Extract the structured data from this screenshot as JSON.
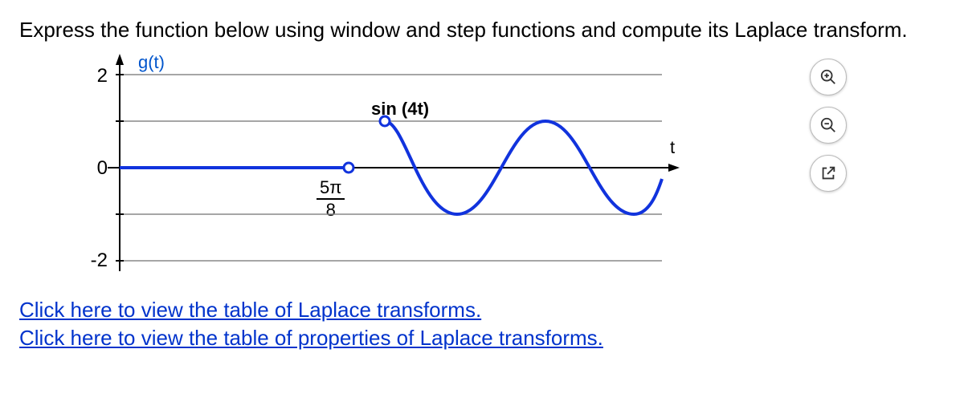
{
  "question": "Express the function below using window and step functions and compute its Laplace transform.",
  "graph": {
    "y_axis_label_function": "g(t)",
    "y_ticks": {
      "top": "2",
      "mid": "0",
      "bot": "-2"
    },
    "x_axis_label": "t",
    "curve_label": "sin (4t)",
    "x_tick_fraction": {
      "num": "5π",
      "den": "8"
    }
  },
  "links": {
    "laplace_table": "Click here to view the table of Laplace transforms.",
    "properties_table": "Click here to view the table of properties of Laplace transforms."
  },
  "chart_data": {
    "type": "line",
    "title": "",
    "xlabel": "t",
    "ylabel": "g(t)",
    "ylim": [
      -2,
      2
    ],
    "x_marked_ticks": [
      "5π/8"
    ],
    "annotations": [
      "sin (4t)"
    ],
    "series": [
      {
        "name": "g(t)",
        "description": "Piecewise: g(t)=0 for 0<=t<5π/8 (open at 5π/8), then g(t)=sin(4t) for t>=5π/8 (starts at 0 with open marker, oscillates amplitude 1, period π/2)",
        "pieces": [
          {
            "interval": "[0, 5π/8)",
            "formula": "0"
          },
          {
            "interval": "[5π/8, ∞)",
            "formula": "sin(4t)"
          }
        ]
      }
    ]
  }
}
